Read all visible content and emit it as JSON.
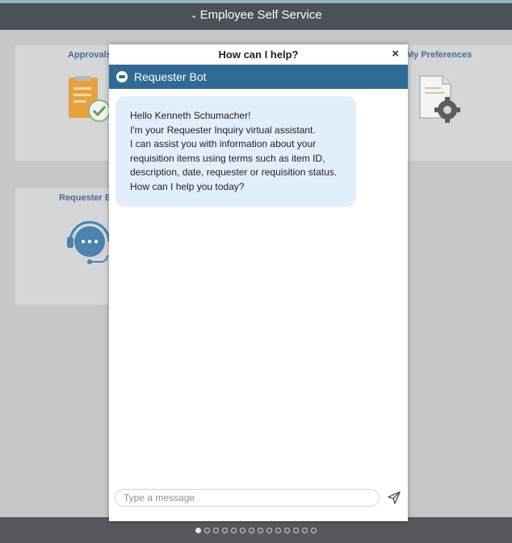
{
  "header": {
    "title": "Employee Self Service"
  },
  "tiles": [
    {
      "title": "Approvals"
    },
    {
      "title": "My Preferences"
    },
    {
      "title": "Requester Bot"
    }
  ],
  "dialog": {
    "title": "How can I help?",
    "close_label": "×",
    "bot_name": "Requester Bot",
    "message_lines": [
      "Hello  Kenneth Schumacher!",
      "I'm your Requester Inquiry virtual assistant.",
      "I can assist you with information about your",
      "requisition items using terms such as item ID,",
      "description, date, requester or requisition status.",
      "How can I help you today?"
    ],
    "input_placeholder": "Type a message"
  },
  "pagination": {
    "count": 14,
    "active": 0
  },
  "colors": {
    "header": "#4b5157",
    "bot_bar": "#2f6a96",
    "bubble": "#e3eefb",
    "tile_title": "#4a6b96"
  }
}
